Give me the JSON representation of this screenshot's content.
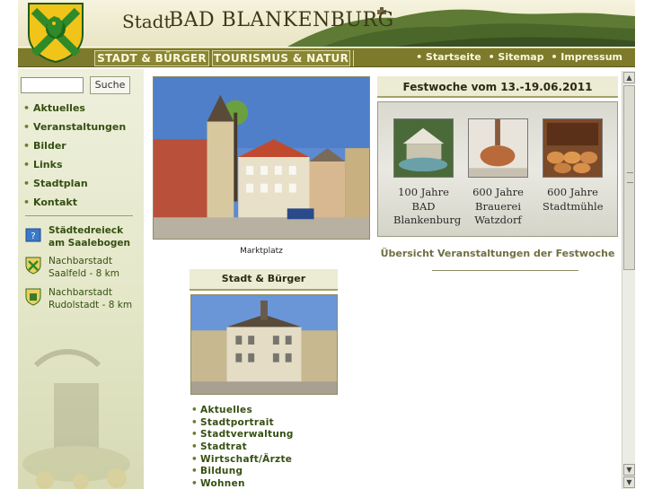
{
  "header": {
    "title_prefix": "Stadt",
    "title_main": "BAD BLANKENBURG"
  },
  "nav": {
    "tabs": [
      {
        "label": "STADT & BÜRGER"
      },
      {
        "label": "TOURISMUS & NATUR"
      }
    ],
    "links": [
      {
        "label": "• Startseite"
      },
      {
        "label": "• Sitemap"
      },
      {
        "label": "• Impressum"
      }
    ]
  },
  "sidebar": {
    "search": {
      "value": "",
      "button_label": "Suche"
    },
    "menu": [
      {
        "label": "Aktuelles"
      },
      {
        "label": "Veranstaltungen"
      },
      {
        "label": "Bilder"
      },
      {
        "label": "Links"
      },
      {
        "label": "Stadtplan"
      },
      {
        "label": "Kontakt"
      }
    ],
    "bullet": "•",
    "links": [
      {
        "line1": "Städtedreieck",
        "line2": "am Saalebogen",
        "icon": "map-icon"
      },
      {
        "line1": "Nachbarstadt",
        "line2": "Saalfeld - 8 km",
        "icon": "crest-icon"
      },
      {
        "line1": "Nachbarstadt",
        "line2": "Rudolstadt - 8 km",
        "icon": "crest-icon"
      }
    ]
  },
  "main": {
    "photo_caption": "Marktplatz",
    "section_title": "Stadt & Bürger",
    "submenu": [
      {
        "label": "Aktuelles"
      },
      {
        "label": "Stadtportrait"
      },
      {
        "label": "Stadtverwaltung"
      },
      {
        "label": "Stadtrat"
      },
      {
        "label": "Wirtschaft/Ärzte"
      },
      {
        "label": "Bildung"
      },
      {
        "label": "Wohnen"
      }
    ]
  },
  "festwoche": {
    "title": "Festwoche vom 13.-19.06.2011",
    "items": [
      {
        "line1": "100 Jahre",
        "line2": "BAD",
        "line3": "Blankenburg"
      },
      {
        "line1": "600 Jahre",
        "line2": "Brauerei",
        "line3": "Watzdorf"
      },
      {
        "line1": "600 Jahre",
        "line2": "Stadtmühle",
        "line3": ""
      }
    ],
    "link": "Übersicht Veranstaltungen der Festwoche"
  },
  "colors": {
    "nav_bg": "#7d7a2c",
    "menu_text": "#355012",
    "sidebar_bg": "#e4e7c8"
  }
}
